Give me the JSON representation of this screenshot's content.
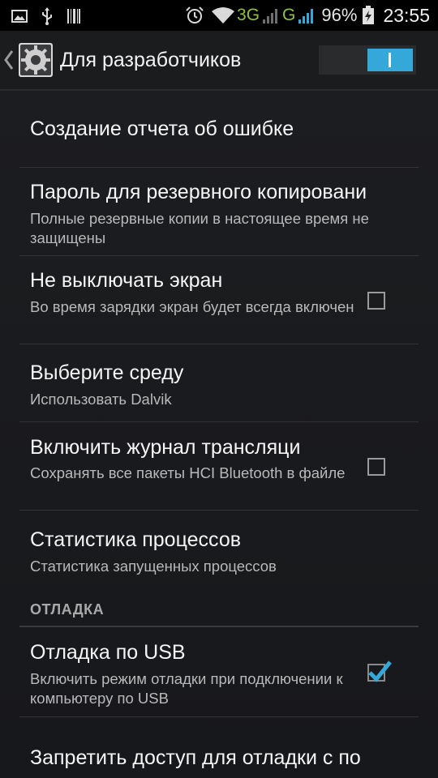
{
  "status_bar": {
    "icons_left": [
      "image-icon",
      "usb-icon",
      "barcode-icon"
    ],
    "network_3g": "3G",
    "network_g": "G",
    "battery": "96%",
    "time": "23:55"
  },
  "action_bar": {
    "title": "Для разработчиков",
    "switch_on": true
  },
  "items": [
    {
      "title": "Создание отчета об ошибке"
    },
    {
      "title": "Пароль для резервного копировани",
      "summary": "Полные резервные копии в настоящее время не защищены"
    },
    {
      "title": "Не выключать экран",
      "summary": "Во время зарядки экран будет всегда включен",
      "checked": false
    },
    {
      "title": "Выберите среду",
      "summary": "Использовать Dalvik"
    },
    {
      "title": "Включить журнал трансляци",
      "summary": "Сохранять все пакеты HCI Bluetooth в файле",
      "checked": false
    },
    {
      "title": "Статистика процессов",
      "summary": "Статистика запущенных процессов"
    },
    {
      "title": "Отладка по USB",
      "summary": "Включить режим отладки при подключении к компьютеру по USB",
      "checked": true
    },
    {
      "title": "Запретить доступ для отладки с по"
    }
  ],
  "section_debug": "ОТЛАДКА",
  "colors": {
    "accent": "#33a8d9",
    "network_green": "#8fc33c",
    "background": "#1b1c1f"
  }
}
